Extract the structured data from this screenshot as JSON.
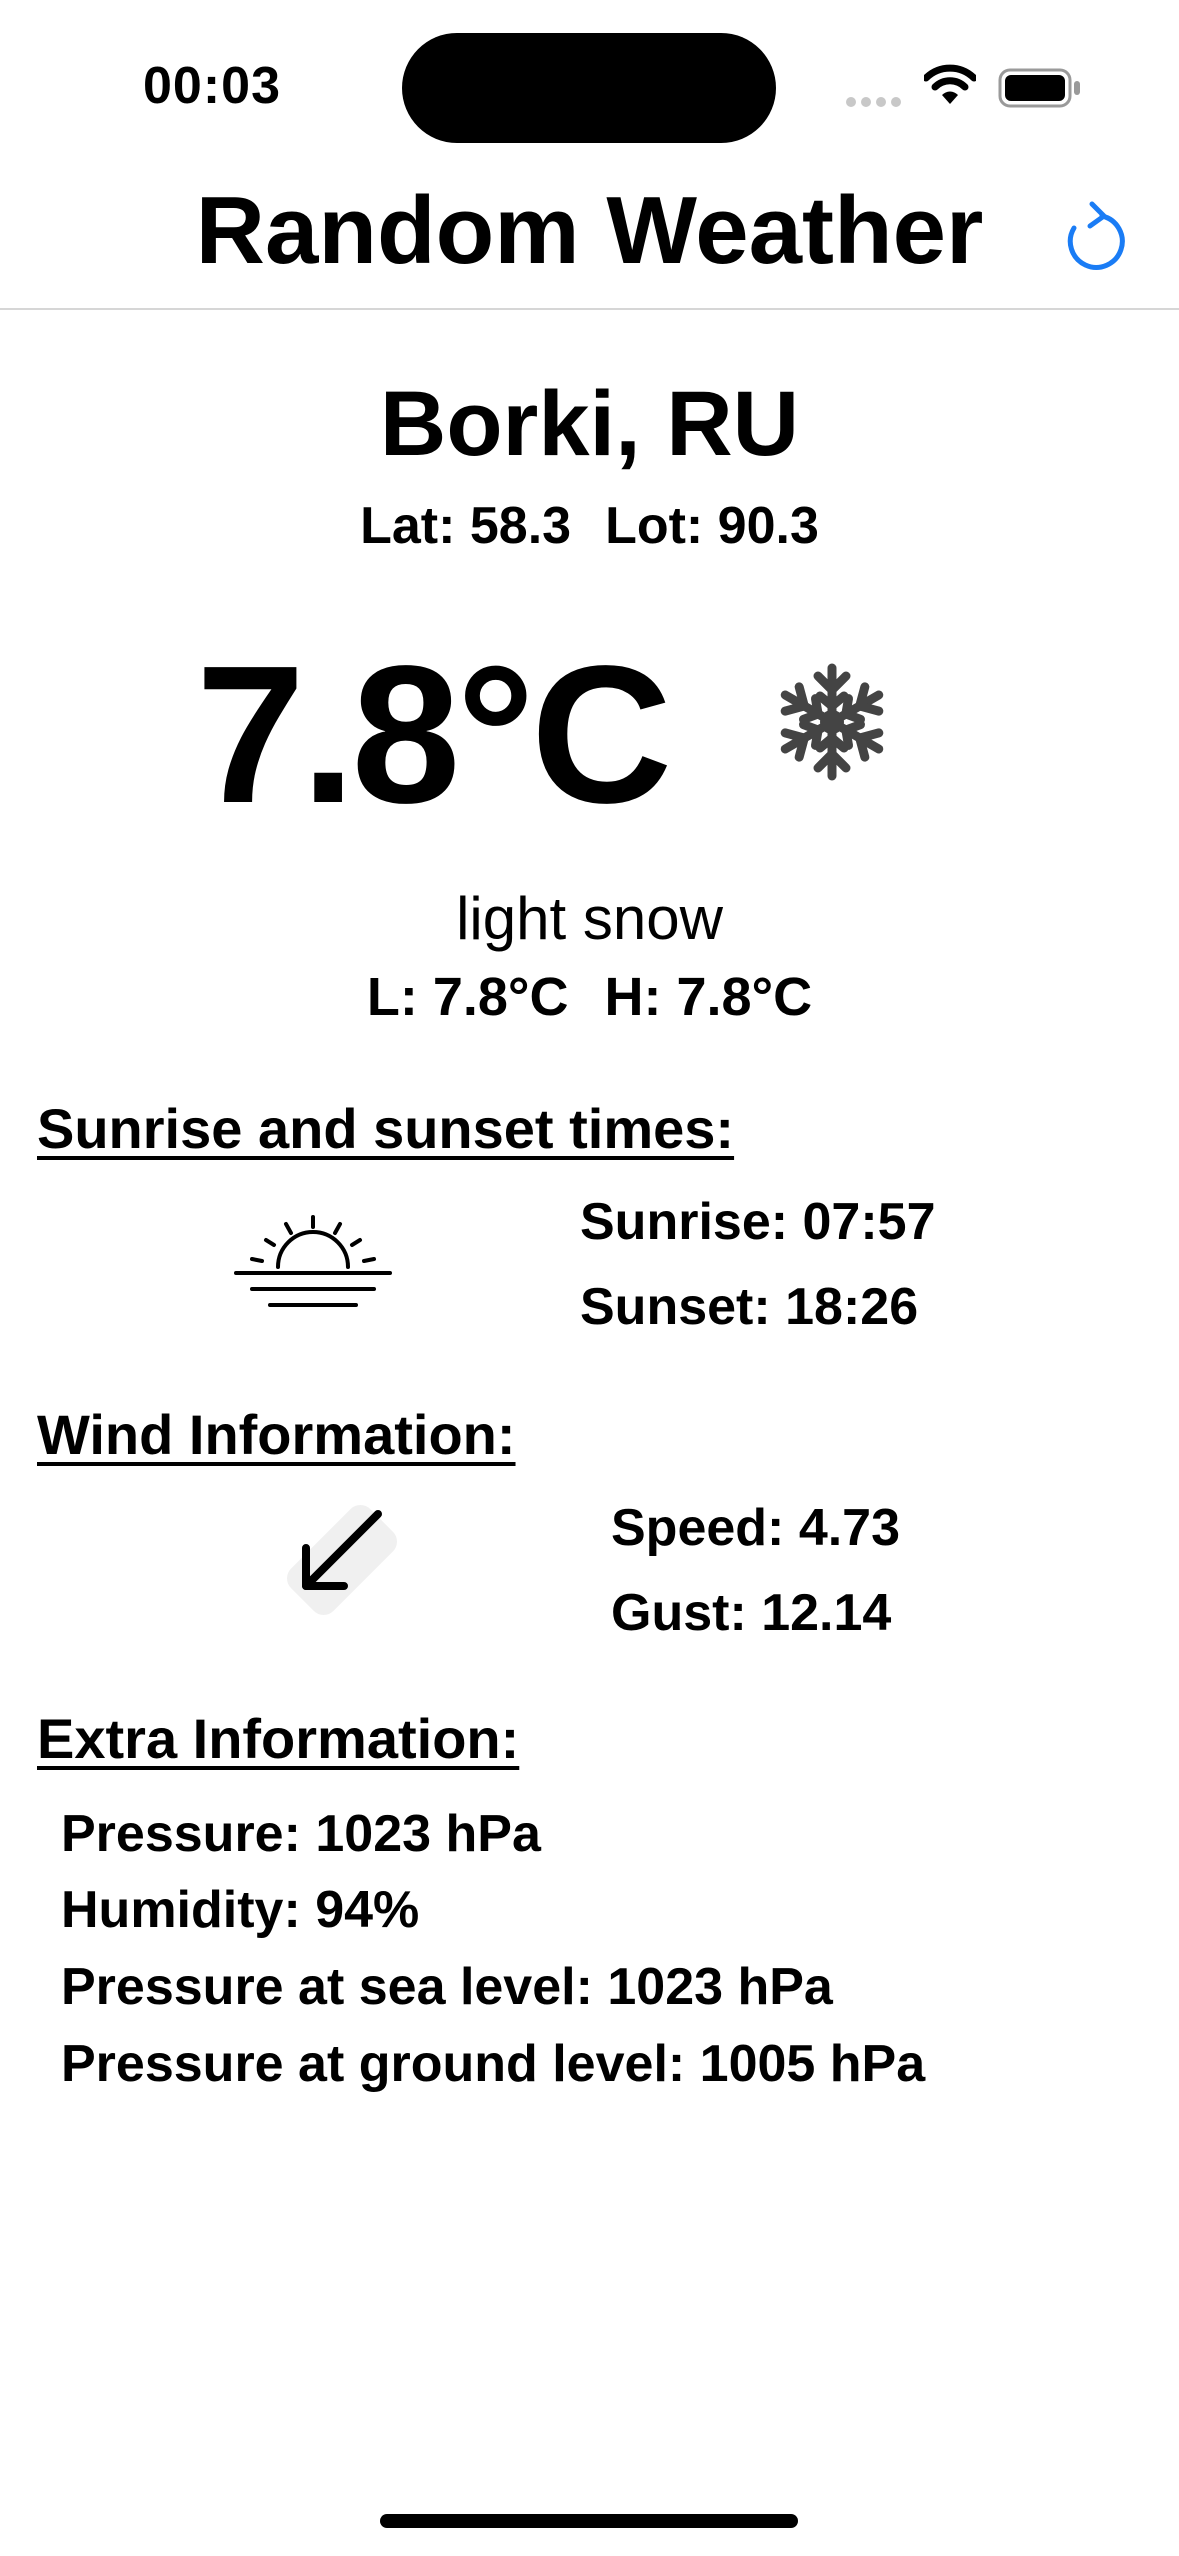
{
  "status_bar": {
    "time": "00:03"
  },
  "nav": {
    "title": "Random Weather",
    "refresh_icon": "refresh-icon",
    "accent_color": "#1a7cf5"
  },
  "location": {
    "city": "Borki, RU",
    "lat": "Lat: 58.3",
    "lot": "Lot: 90.3"
  },
  "current": {
    "temperature": "7.8°C",
    "condition_icon": "snowflake-icon",
    "description": "light snow",
    "low": "L: 7.8°C",
    "high": "H: 7.8°C"
  },
  "sun": {
    "heading": "Sunrise and sunset times:",
    "icon": "sunset-icon",
    "sunrise": "Sunrise: 07:57",
    "sunset": "Sunset: 18:26"
  },
  "wind": {
    "heading": "Wind Information:",
    "icon": "wind-direction-arrow-icon",
    "speed": "Speed: 4.73",
    "gust": "Gust: 12.14"
  },
  "extra": {
    "heading": "Extra Information:",
    "lines": [
      "Pressure: 1023 hPa",
      "Humidity: 94%",
      "Pressure at sea level: 1023 hPa",
      "Pressure at ground level: 1005 hPa"
    ]
  }
}
